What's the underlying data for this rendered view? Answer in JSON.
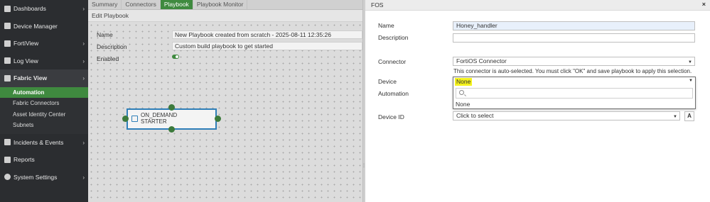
{
  "sidebar": {
    "items": [
      {
        "label": "Dashboards",
        "chevron": true
      },
      {
        "label": "Device Manager",
        "chevron": false
      },
      {
        "label": "FortiView",
        "chevron": true
      },
      {
        "label": "Log View",
        "chevron": true
      },
      {
        "label": "Fabric View",
        "chevron": true
      },
      {
        "label": "Incidents & Events",
        "chevron": true
      },
      {
        "label": "Reports",
        "chevron": false
      },
      {
        "label": "System Settings",
        "chevron": true
      }
    ],
    "fabric_sub": [
      "Automation",
      "Fabric Connectors",
      "Asset Identity Center",
      "Subnets"
    ]
  },
  "tabs": [
    "Summary",
    "Connectors",
    "Playbook",
    "Playbook Monitor"
  ],
  "active_tab": "Playbook",
  "edit_header": "Edit Playbook",
  "playbook": {
    "name_label": "Name",
    "name_value": "New Playbook created from scratch - 2025-08-11 12:35:26",
    "description_label": "Description",
    "description_value": "Custom build playbook to get started",
    "enabled_label": "Enabled"
  },
  "node": {
    "line1": "ON_DEMAND",
    "line2": "STARTER"
  },
  "panel": {
    "title": "FOS",
    "close": "×",
    "name_label": "Name",
    "name_value": "Honey_handler",
    "description_label": "Description",
    "connector_label": "Connector",
    "connector_value": "FortiOS Connector",
    "connector_hint": "This connector is auto-selected. You must click \"OK\" and save playbook to apply this selection.",
    "device_label": "Device",
    "device_value": "None",
    "device_option": "None",
    "automation_label": "Automation",
    "device_id_label": "Device ID",
    "device_id_placeholder": "Click to select",
    "a_button": "A"
  },
  "colors": {
    "accent": "#3f8a3f",
    "sidebar": "#2b2d30",
    "highlight": "#f4f21d",
    "node_border": "#2f7fb8"
  }
}
